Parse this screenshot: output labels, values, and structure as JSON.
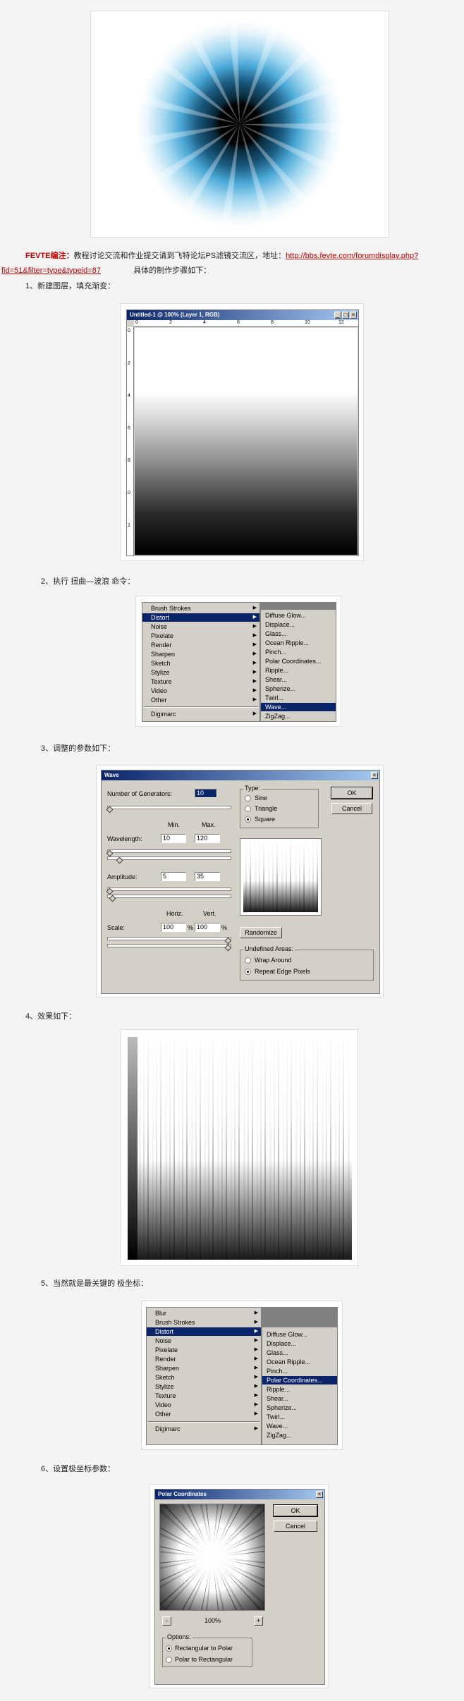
{
  "note": {
    "editor_label": "FEVTE编注：",
    "text_before_link": "教程讨论交流和作业提交请到飞特论坛PS滤镜交流区，地址：",
    "link_line1": "http://bbs.fevte.com/forumdisplay.php?",
    "link_line2": "fid=51&filter=type&typeid=87",
    "text_after_link": "具体的制作步骤如下："
  },
  "steps": [
    "1、新建图层，填充渐变：",
    "2、执行 扭曲—波浪 命令：",
    "3、调整的参数如下：",
    "4、效果如下：",
    "5、当然就是最关键的 极坐标：",
    "6、设置极坐标参数："
  ],
  "ps_window": {
    "title": "Untitled-1 @ 100% (Layer 1, RGB)",
    "ruler_top": [
      "0",
      "2",
      "4",
      "6",
      "8",
      "10",
      "12"
    ],
    "ruler_left": [
      "0",
      "2",
      "4",
      "6",
      "8",
      "0",
      "1"
    ],
    "buttons": [
      "_",
      "□",
      "×"
    ]
  },
  "menu1": {
    "left_items": [
      "Brush Strokes",
      "Distort",
      "Noise",
      "Pixelate",
      "Render",
      "Sharpen",
      "Sketch",
      "Stylize",
      "Texture",
      "Video",
      "Other",
      "Digimarc"
    ],
    "selected_left": "Distort",
    "right_items": [
      "Diffuse Glow...",
      "Displace...",
      "Glass...",
      "Ocean Ripple...",
      "Pinch...",
      "Polar Coordinates...",
      "Ripple...",
      "Shear...",
      "Spherize...",
      "Twirl...",
      "Wave...",
      "ZigZag..."
    ],
    "selected_right": "Wave..."
  },
  "wave": {
    "title": "Wave",
    "generators_label": "Number of Generators:",
    "generators_value": "10",
    "min_label": "Min.",
    "max_label": "Max.",
    "wavelength_label": "Wavelength:",
    "wavelength_min": "10",
    "wavelength_max": "120",
    "amplitude_label": "Amplitude:",
    "amplitude_min": "5",
    "amplitude_max": "35",
    "horiz_label": "Horiz.",
    "vert_label": "Vert.",
    "scale_label": "Scale:",
    "scale_h": "100",
    "scale_v": "100",
    "pct": "%",
    "type_label": "Type:",
    "type_options": [
      "Sine",
      "Triangle",
      "Square"
    ],
    "type_selected": "Square",
    "ok": "OK",
    "cancel": "Cancel",
    "randomize": "Randomize",
    "undefined_label": "Undefined Areas:",
    "undefined_options": [
      "Wrap Around",
      "Repeat Edge Pixels"
    ],
    "undefined_selected": "Repeat Edge Pixels"
  },
  "menu2": {
    "left_items": [
      "Blur",
      "Brush Strokes",
      "Distort",
      "Noise",
      "Pixelate",
      "Render",
      "Sharpen",
      "Sketch",
      "Stylize",
      "Texture",
      "Video",
      "Other",
      "Digimarc"
    ],
    "selected_left": "Distort",
    "right_items": [
      "Diffuse Glow...",
      "Displace...",
      "Glass...",
      "Ocean Ripple...",
      "Pinch...",
      "Polar Coordinates...",
      "Ripple...",
      "Shear...",
      "Spherize...",
      "Twirl...",
      "Wave...",
      "ZigZag..."
    ],
    "selected_right": "Polar Coordinates..."
  },
  "polar": {
    "title": "Polar Coordinates",
    "ok": "OK",
    "cancel": "Cancel",
    "zoom": "100%",
    "minus": "-",
    "plus": "+",
    "options_label": "Options:",
    "options": [
      "Rectangular to Polar",
      "Polar to Rectangular"
    ],
    "selected": "Rectangular to Polar"
  }
}
